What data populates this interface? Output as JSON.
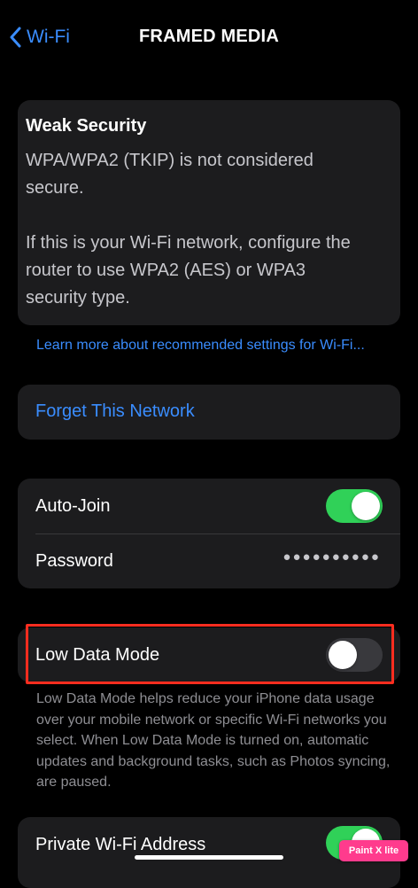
{
  "nav": {
    "back_label": "Wi-Fi",
    "title": "FRAMED MEDIA"
  },
  "warning": {
    "title": "Weak Security",
    "body": "WPA/WPA2 (TKIP) is not considered secure.\n\nIf this is your Wi-Fi network, configure the router to use WPA2 (AES) or WPA3 security type."
  },
  "learn_more_link": "Learn more about recommended settings for Wi-Fi...",
  "forget_label": "Forget This Network",
  "auto_join": {
    "label": "Auto-Join",
    "enabled": true
  },
  "password": {
    "label": "Password",
    "masked_value": "●●●●●●●●●●"
  },
  "low_data_mode": {
    "label": "Low Data Mode",
    "enabled": false,
    "description": "Low Data Mode helps reduce your iPhone data usage over your mobile network or specific Wi-Fi networks you select. When Low Data Mode is turned on, automatic updates and background tasks, such as Photos syncing, are paused."
  },
  "private_address": {
    "label": "Private Wi-Fi Address",
    "enabled": true
  },
  "watermark": "Paint X lite",
  "colors": {
    "accent": "#3a8dff",
    "toggle_on": "#30d158",
    "highlight_border": "#ff2d1f",
    "card_bg": "#1c1c1e"
  },
  "icons": {
    "back": "chevron-left-icon"
  }
}
